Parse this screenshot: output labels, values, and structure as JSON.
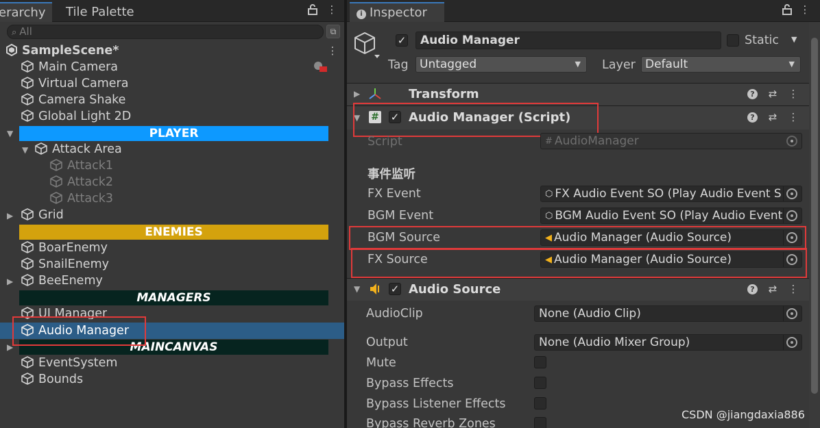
{
  "hierarchy": {
    "tab_label": "erarchy",
    "tab2_label": "Tile Palette",
    "search_placeholder": "All",
    "scene_name": "SampleScene*",
    "items": {
      "main_camera": "Main Camera",
      "virtual_camera": "Virtual Camera",
      "camera_shake": "Camera Shake",
      "global_light": "Global Light 2D",
      "attack_area": "Attack Area",
      "attack1": "Attack1",
      "attack2": "Attack2",
      "attack3": "Attack3",
      "grid": "Grid",
      "boar": "BoarEnemy",
      "snail": "SnailEnemy",
      "bee": "BeeEnemy",
      "ui_manager": "UI Manager",
      "audio_manager": "Audio Manager",
      "event_system": "EventSystem",
      "bounds": "Bounds"
    },
    "headers": {
      "player": "PLAYER",
      "enemies": "ENEMIES",
      "managers": "MANAGERS",
      "maincanvas": "MAINCANVAS"
    },
    "header_colors": {
      "player": "#0d99ff",
      "enemies": "#d4a20d",
      "managers": "#06241f",
      "maincanvas": "#06241f"
    }
  },
  "inspector": {
    "tab_label": "Inspector",
    "object_name": "Audio Manager",
    "static_label": "Static",
    "tag_label": "Tag",
    "tag_value": "Untagged",
    "layer_label": "Layer",
    "layer_value": "Default",
    "components": {
      "transform": "Transform",
      "audio_manager_script": "Audio Manager (Script)",
      "audio_source": "Audio Source"
    },
    "script": {
      "script_label": "Script",
      "script_value": "AudioManager",
      "section_title": "事件监听",
      "fx_event_label": "FX Event",
      "fx_event_value": "FX Audio Event SO (Play Audio Event S",
      "bgm_event_label": "BGM Event",
      "bgm_event_value": "BGM Audio Event SO (Play Audio Event",
      "bgm_source_label": "BGM Source",
      "bgm_source_value": "Audio Manager (Audio Source)",
      "fx_source_label": "FX Source",
      "fx_source_value": "Audio Manager (Audio Source)"
    },
    "audio_source": {
      "clip_label": "AudioClip",
      "clip_value": "None (Audio Clip)",
      "output_label": "Output",
      "output_value": "None (Audio Mixer Group)",
      "mute_label": "Mute",
      "bypass_effects_label": "Bypass Effects",
      "bypass_listener_label": "Bypass Listener Effects",
      "bypass_reverb_label": "Bypass Reverb Zones"
    }
  },
  "watermark": "CSDN @jiangdaxia886"
}
